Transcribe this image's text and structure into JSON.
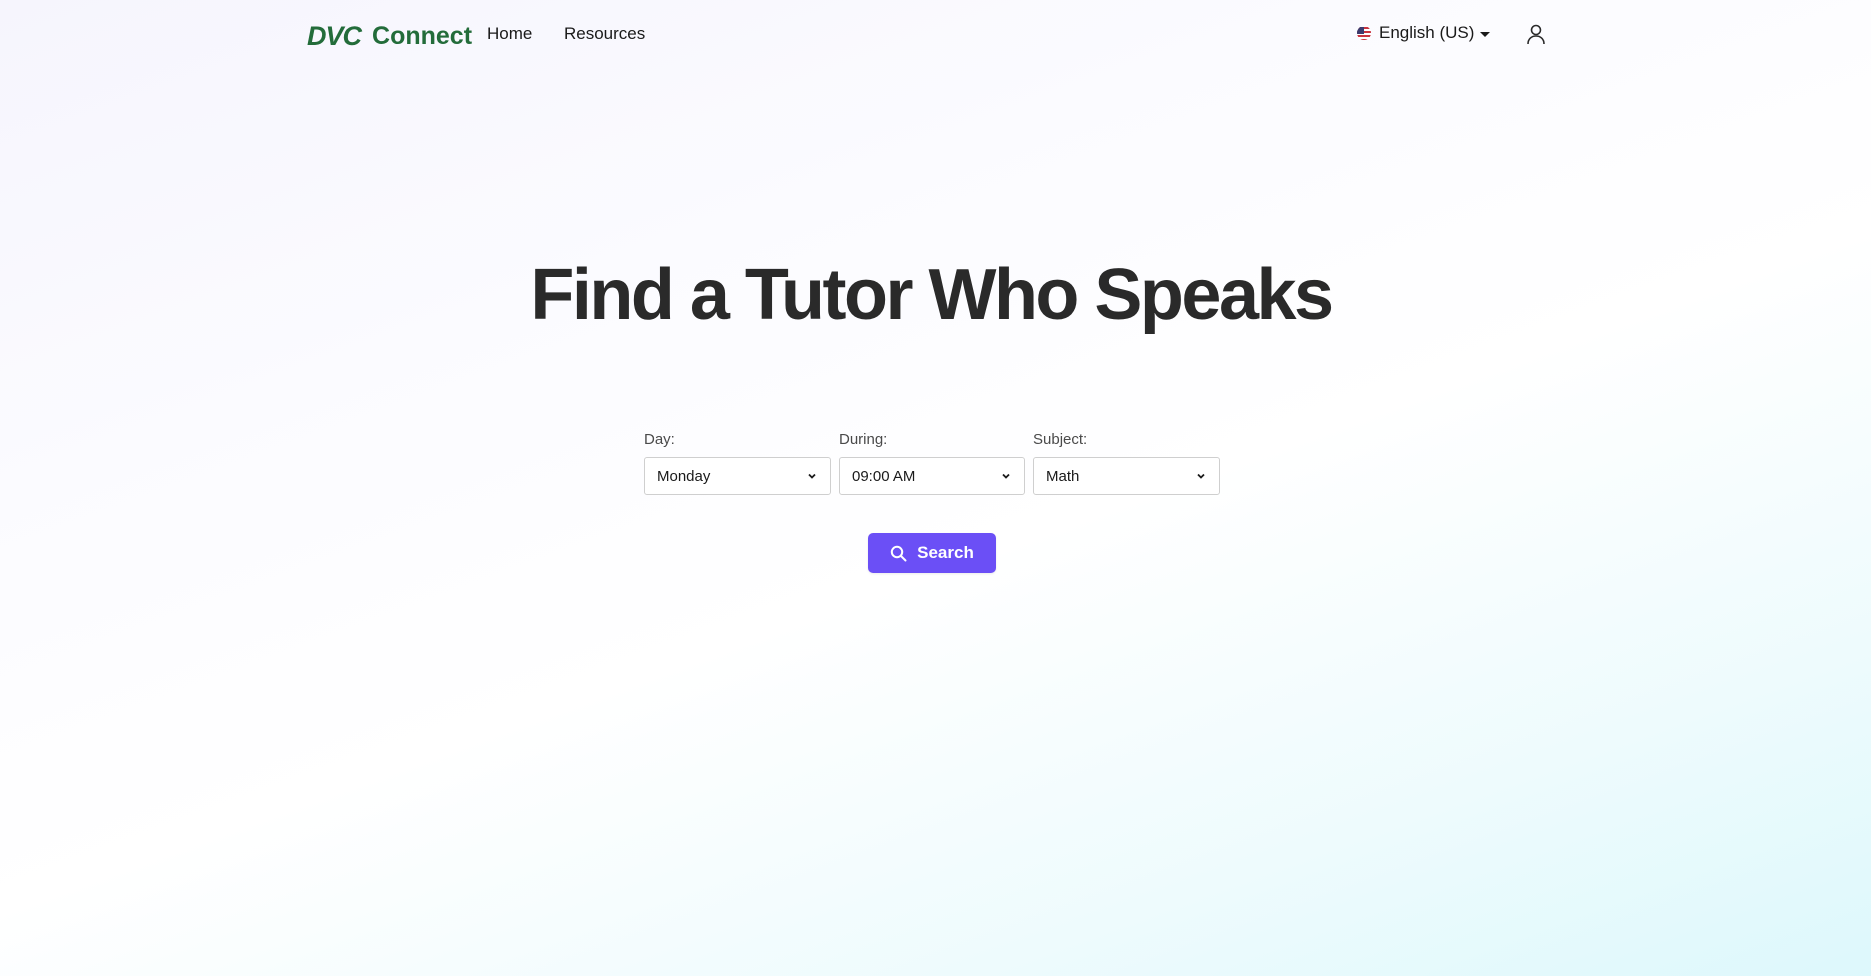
{
  "brand": {
    "mark": "DVC",
    "name": "Connect",
    "color": "#236c3a"
  },
  "nav": {
    "links": [
      {
        "label": "Home"
      },
      {
        "label": "Resources"
      }
    ],
    "language": {
      "label": "English (US)",
      "icon": "us-flag-icon"
    },
    "account_icon": "user-icon"
  },
  "hero": {
    "title": "Find a Tutor Who Speaks"
  },
  "filters": {
    "day": {
      "label": "Day:",
      "value": "Monday"
    },
    "during": {
      "label": "During:",
      "value": "09:00 AM"
    },
    "subject": {
      "label": "Subject:",
      "value": "Math"
    }
  },
  "search_button": {
    "label": "Search",
    "icon": "search-icon",
    "color": "#6b4ff6"
  }
}
